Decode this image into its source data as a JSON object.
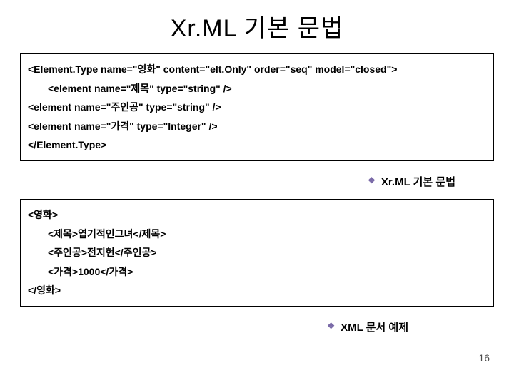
{
  "title": "Xr.ML 기본 문법",
  "box1": {
    "l1": "<Element.Type name=\"영화\" content=\"elt.Only\" order=\"seq\" model=\"closed\">",
    "l2": "<element name=\"제목\" type=\"string\" />",
    "l3": "<element name=\"주인공\" type=\"string\" />",
    "l4": "<element name=\"가격\" type=\"Integer\" />",
    "l5": "</Element.Type>"
  },
  "caption1": "Xr.ML 기본 문법",
  "box2": {
    "l1": "<영화>",
    "l2": "<제목>엽기적인그녀</제목>",
    "l3": "<주인공>전지현</주인공>",
    "l4": "<가격>1000</가격>",
    "l5": "</영화>"
  },
  "caption2": "XML 문서 예제",
  "page": "16"
}
